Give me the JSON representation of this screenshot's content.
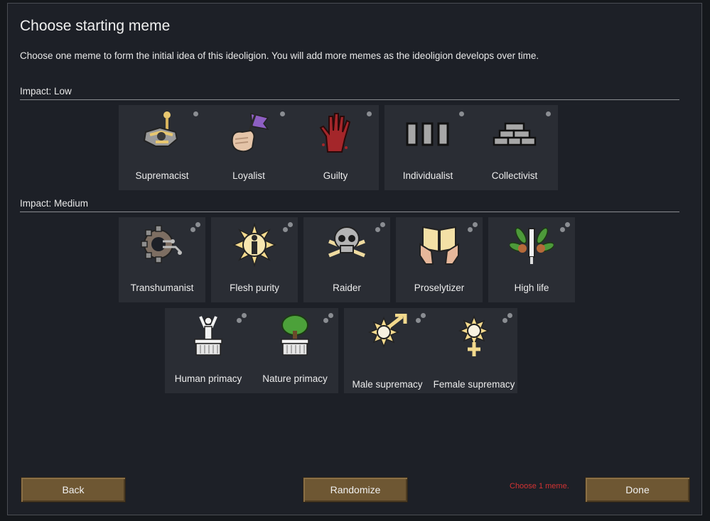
{
  "dialog": {
    "title": "Choose starting meme",
    "description": "Choose one meme to form the initial idea of this ideoligion. You will add more memes as the ideoligion develops over time."
  },
  "sections": {
    "low": {
      "label": "Impact: Low"
    },
    "medium": {
      "label": "Impact: Medium"
    }
  },
  "memes": {
    "supremacist": {
      "label": "Supremacist",
      "icon": "supremacist-icon"
    },
    "loyalist": {
      "label": "Loyalist",
      "icon": "loyalist-icon"
    },
    "guilty": {
      "label": "Guilty",
      "icon": "guilty-icon"
    },
    "individualist": {
      "label": "Individualist",
      "icon": "individualist-icon"
    },
    "collectivist": {
      "label": "Collectivist",
      "icon": "collectivist-icon"
    },
    "transhumanist": {
      "label": "Transhumanist",
      "icon": "transhumanist-icon"
    },
    "flesh_purity": {
      "label": "Flesh purity",
      "icon": "flesh-purity-icon"
    },
    "raider": {
      "label": "Raider",
      "icon": "raider-icon"
    },
    "proselytizer": {
      "label": "Proselytizer",
      "icon": "proselytizer-icon"
    },
    "high_life": {
      "label": "High life",
      "icon": "high-life-icon"
    },
    "human_primacy": {
      "label": "Human primacy",
      "icon": "human-primacy-icon"
    },
    "nature_primacy": {
      "label": "Nature primacy",
      "icon": "nature-primacy-icon"
    },
    "male_supremacy": {
      "label": "Male supremacy",
      "icon": "male-supremacy-icon"
    },
    "female_supremacy": {
      "label": "Female supremacy",
      "icon": "female-supremacy-icon"
    }
  },
  "buttons": {
    "back": "Back",
    "randomize": "Randomize",
    "done": "Done"
  },
  "status": {
    "warning": "Choose 1 meme."
  },
  "colors": {
    "button_brown": "#6e5733",
    "warning_red": "#d33333",
    "panel": "#1d2027",
    "tile": "#2a2d34"
  }
}
